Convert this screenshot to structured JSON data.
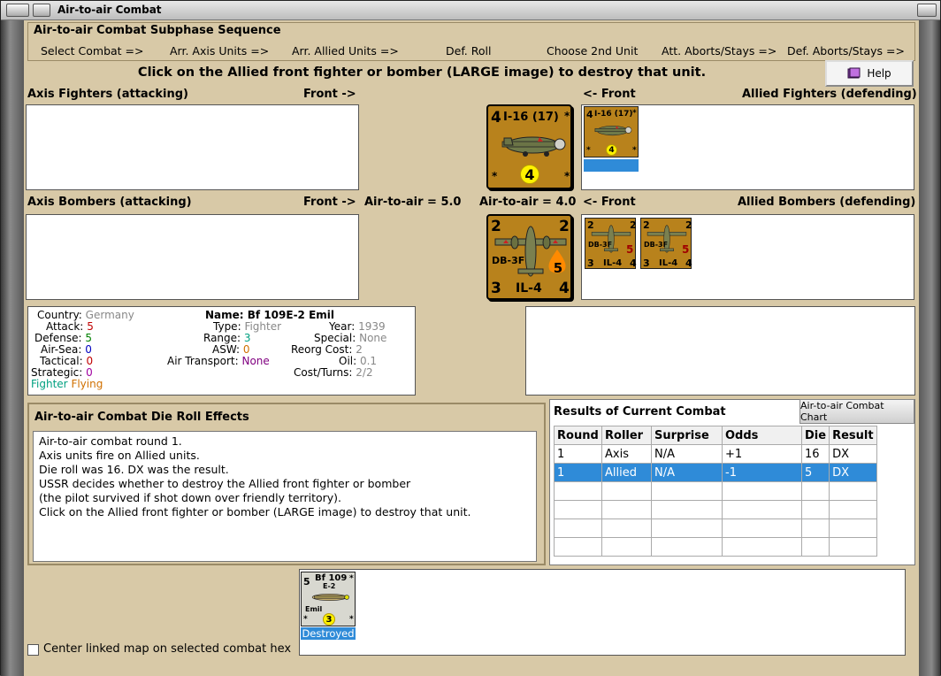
{
  "window": {
    "title": "Air-to-air Combat"
  },
  "sequence": {
    "title": "Air-to-air Combat Subphase Sequence",
    "steps": [
      "Select Combat =>",
      "Arr. Axis Units =>",
      "Arr. Allied Units =>",
      "Def. Roll",
      "Choose 2nd Unit",
      "Att. Aborts/Stays =>",
      "Def. Aborts/Stays =>"
    ]
  },
  "instruction": "Click on the Allied front fighter or bomber (LARGE image) to destroy that unit.",
  "help_label": "Help",
  "labels": {
    "axis_fighters": "Axis Fighters (attacking)",
    "front_right_1": "Front ->",
    "front_left_1": "<- Front",
    "allied_fighters": "Allied Fighters (defending)",
    "axis_bombers": "Axis Bombers (attacking)",
    "front_right_2": "Front ->",
    "axis_air_to_air": "Air-to-air = 5.0",
    "allied_air_to_air": "Air-to-air = 4.0",
    "front_left_2": "<- Front",
    "allied_bombers": "Allied Bombers (defending)"
  },
  "fighter_counter": {
    "name": "I-16 (17)",
    "attack": "4",
    "corner": "*",
    "value": "4"
  },
  "fighter_small": {
    "name": "I-16 (17)",
    "attack": "4",
    "corner": "*",
    "value": "4"
  },
  "bomber_counter": {
    "name": "DB-3F",
    "sub": "IL-4",
    "tl": "2",
    "tr": "2",
    "bl": "3",
    "br": "4",
    "value": "5"
  },
  "bomber_small": [
    {
      "name": "DB-3F",
      "sub": "IL-4",
      "tl": "2",
      "tr": "2",
      "bl": "3",
      "br": "4",
      "value": "5"
    },
    {
      "name": "DB-3F",
      "sub": "IL-4",
      "tl": "2",
      "tr": "2",
      "bl": "3",
      "br": "4",
      "value": "5"
    }
  ],
  "unit_info": {
    "country_k": "Country:",
    "country_v": "Germany",
    "attack_k": "Attack:",
    "attack_v": "5",
    "defense_k": "Defense:",
    "defense_v": "5",
    "airsea_k": "Air-Sea:",
    "airsea_v": "0",
    "tactical_k": "Tactical:",
    "tactical_v": "0",
    "strategic_k": "Strategic:",
    "strategic_v": "0",
    "fighter": "Fighter",
    "flying": "Flying",
    "name_k": "Name:",
    "name_v": "Bf 109E-2 Emil",
    "type_k": "Type:",
    "type_v": "Fighter",
    "range_k": "Range:",
    "range_v": "3",
    "asw_k": "ASW:",
    "asw_v": "0",
    "airtransport_k": "Air Transport:",
    "airtransport_v": "None",
    "year_k": "Year:",
    "year_v": "1939",
    "special_k": "Special:",
    "special_v": "None",
    "reorg_k": "Reorg Cost:",
    "reorg_v": "2",
    "oil_k": "Oil:",
    "oil_v": "0.1",
    "costturns_k": "Cost/Turns:",
    "costturns_v": "2/2"
  },
  "die_effects": {
    "title": "Air-to-air Combat Die Roll Effects",
    "lines": [
      "Air-to-air combat round 1.",
      "Axis units fire on Allied units.",
      "Die roll was 16.  DX was the result.",
      "USSR decides whether to destroy the Allied front fighter or bomber",
      "(the pilot survived if shot down over friendly territory).",
      "Click on the Allied front fighter or bomber (LARGE image) to destroy that unit."
    ]
  },
  "results": {
    "title": "Results of Current Combat",
    "chart_button": "Air-to-air Combat Chart",
    "columns": [
      "Round",
      "Roller",
      "Surprise",
      "Odds",
      "Die",
      "Result"
    ],
    "rows": [
      [
        "1",
        "Axis",
        "N/A",
        "+1",
        "16",
        "DX"
      ],
      [
        "1",
        "Allied",
        "N/A",
        "-1",
        "5",
        "DX"
      ]
    ]
  },
  "destroyed_unit": {
    "name": "Bf 109",
    "sub": "E-2",
    "nick": "Emil",
    "attack": "5",
    "corner": "*",
    "value": "3",
    "caption": "Destroyed"
  },
  "center_map_label": "Center linked map on selected combat hex",
  "colors": {
    "counter_orange": "#b8821c",
    "selection_blue": "#2f8bd8",
    "panel_tan": "#d8c9a7"
  }
}
